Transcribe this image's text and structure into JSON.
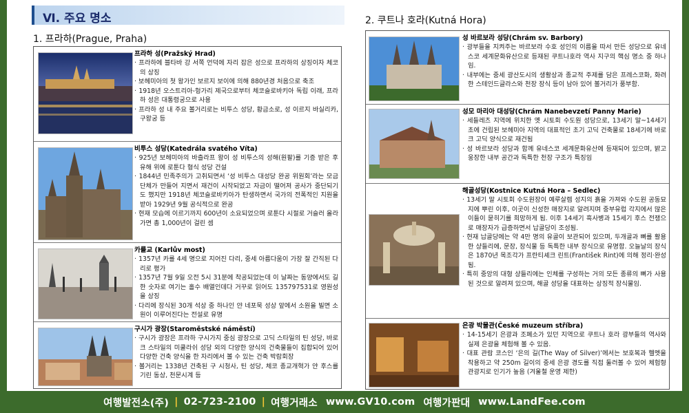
{
  "section_title": "Ⅵ. 주요 명소",
  "left": {
    "subtitle": "1. 프라하(Prague, Praha)",
    "items": [
      {
        "title": "프라하 성(Pražský Hrad)",
        "lines": [
          "· 프라하에 블타바 강 서쪽 언덕에 자리 잡은 성으로 프라하의 상징이자 체코의 상징",
          "· 보헤미아의 첫 왕가인 보르지 보이에 의해 880년경 처음으로 축조",
          "· 1918년 오스트리아-헝가리 제국으로부터 체코슬로바키아 독립 이래, 프라하 성은 대통령궁으로 사용",
          "· 프라하 성 내 주요 볼거리로는 비투스 성당, 황금소로, 성 이르지 바실리카, 구왕궁 등"
        ]
      },
      {
        "title": "비투스 성당(Katedrála svatého Víta)",
        "lines": [
          "· 925년 보헤미아의 바츨라프 왕이 성 비투스의 성해(원팔)를 기증 받은 후 유해 위에 로툰다 형식 성당 건설",
          "· 1844년 민족주의가 고취되면서 ‘성 비투스 대성당 완공 위원회’라는 모금 단체가 만들어 지면서 재건이 시작되었고 자금이 떨어져 공사가 중단되기도 했지만 1918년 체코슬로바키아가 탄생하면서 국가의 전폭적인 지원을 받아 1929년 9월 공식적으로 완공",
          "· 현재 모습에 이르기까지 600년이 소요되었으며 로툰다 시절로 거슬러 올라가면 총 1,000년이 걸린 셈"
        ]
      },
      {
        "title": "카를교 (Karlův most)",
        "lines": [
          "· 1357년 카를 4세 명으로 지어진 다리, 중세 아름다움이 가장 잘 간직된 다리로 평가",
          "· 1357년 7월 9일 오전 5시 31분에 착공되었는데 이 날짜는 동양에서도 길한 숫자로 여기는 홀수 배열인데다 거꾸로 읽어도 135797531로 영원성을 상징",
          "· 다리에 장식된 30개 석상 중 하나인 얀 네포묵 성상 앞에서 소원을 빌면 소원이 이루어진다는 전설로 유명"
        ]
      },
      {
        "title": "구시가 광장(Staroměstské náměstí)",
        "lines": [
          "· 구시가 광장은 프라하 구시가지 중심 광장으로 고딕 스타일의 틴 성당, 바로크 스타일의 미쿨라쉬 성당 외의 다양한 양식의 건축물들이 집합되어 있어 다양한 건축 양식을 한 자리에서 볼 수 있는 건축 박람회장",
          "· 볼거리는 1338년 건축된 구 시청사, 틴 성당, 체코 종교개혁가 얀 후스를 기린 동상, 천문시계 등"
        ]
      }
    ]
  },
  "right": {
    "subtitle": "2. 쿠트나 호라(Kutná Hora)",
    "items": [
      {
        "title": "성 바르보라 성당(Chrám sv. Barbory)",
        "lines": [
          "· 광부들을 지켜주는 바르보라 수호 성인의 이름을 따서 만든 성당으로 유네스코 세계문화유산으로 등재된 쿠트나호라 역사 지구의 핵심 명소 중 하나임.",
          "· 내부에는 중세 광산도시의 생활상과 종교적 주제를 담은 프레스코화, 화려한 스테인드글라스와 천장 장식 등이 남아 있어 볼거리가 풍부함."
        ]
      },
      {
        "title": "성모 마리아 대성당(Chrám Nanebevzetí Panny Marie)",
        "lines": [
          "· 세들레츠 지역에 위치한 옛 시토회 수도원 성당으로, 13세기 말~14세기 초에 건립된 보헤미아 지역의 대표적인 초기 고딕 건축물로 18세기에 바로크 고딕 양식으로 재건됨",
          "· 성 바르보라 성당과 함께 유네스코 세계문화유산에 등재되어 있으며, 밝고 웅장한 내부 공간과 독특한 천장 구조가 특징임"
        ]
      },
      {
        "title": "해골성당(Kostnice Kutná Hora – Sedlec)",
        "lines": [
          "· 13세기 말 시토회 수도원장이 예루살렘 성지의 흙을 가져와 수도원 공동묘지에 뿌린 이후, 이곳이 신성한 매장지로 알려지며 중부유럽 각지에서 많은 이들이 묻히기를 희망하게 됨. 이후 14세기 흑사병과 15세기 후스 전쟁으로 매장자가 급증하면서 납골당이 조성됨.",
          "· 현재 납골당에는 약 4만 명의 유골이 보관되어 있으며, 두개골과 뼈를 활용한 샹들리에, 문장, 장식물 등 독특한 내부 장식으로 유명함. 오늘날의 장식은 1870년 목조각가 프란티셰크 린트(František Rint)에 의해 정리·완성됨.",
          "· 특히 중앙의 대형 샹들리에는 인체를 구성하는 거의 모든 종류의 뼈가 사용된 것으로 알려져 있으며, 해골 성당을 대표하는 상징적 장식물임."
        ]
      },
      {
        "title": "은광 박물관(České muzeum stříbra)",
        "lines": [
          "· 14-15세기 은광과 조폐소가 있던 지역으로 쿠트나 호라 광부들의 역사와 실제 은광을 체험해 볼 수 있음.",
          "· 대표 관람 코스인 ‘은의 길(The Way of Silver)’에서는 보호복과 헬멧을 착용하고 약 250m 길이의 중세 은광 경도를 직접 둘러볼 수 있어 체험형 관광지로 인기가 높음 (겨울철 운영 제한)"
        ]
      }
    ]
  },
  "footer": {
    "company": "여행발전소(주)",
    "phone": "02-723-2100",
    "label1": "여행거래소",
    "site1": "www.GV10.com",
    "label2": "여행가판대",
    "site2": "www.LandFee.com",
    "separator": "|"
  }
}
